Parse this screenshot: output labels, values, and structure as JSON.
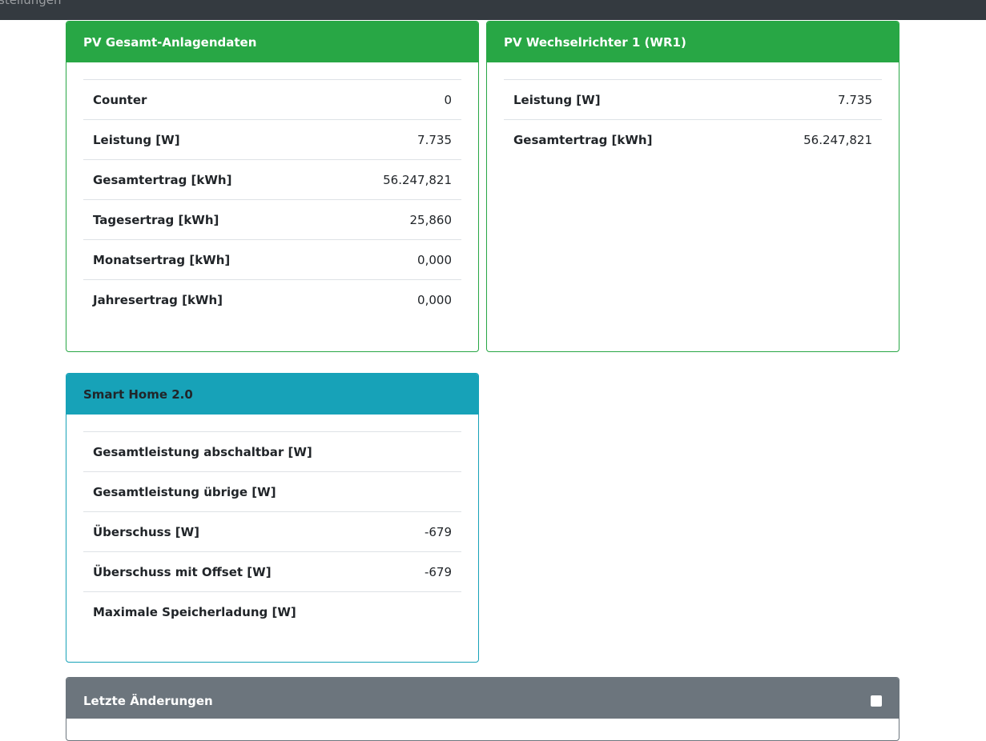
{
  "navbar": {
    "partial_label": "stellungen"
  },
  "pv_total": {
    "title": "PV Gesamt-Anlagendaten",
    "rows": [
      {
        "label": "Counter",
        "value": "0"
      },
      {
        "label": "Leistung [W]",
        "value": "7.735"
      },
      {
        "label": "Gesamtertrag [kWh]",
        "value": "56.247,821"
      },
      {
        "label": "Tagesertrag [kWh]",
        "value": "25,860"
      },
      {
        "label": "Monatsertrag [kWh]",
        "value": "0,000"
      },
      {
        "label": "Jahresertrag [kWh]",
        "value": "0,000"
      }
    ]
  },
  "inverter1": {
    "title": "PV Wechselrichter 1 (WR1)",
    "rows": [
      {
        "label": "Leistung [W]",
        "value": "7.735"
      },
      {
        "label": "Gesamtertrag [kWh]",
        "value": "56.247,821"
      }
    ]
  },
  "smarthome": {
    "title": "Smart Home 2.0",
    "rows": [
      {
        "label": "Gesamtleistung abschaltbar [W]",
        "value": ""
      },
      {
        "label": "Gesamtleistung übrige [W]",
        "value": ""
      },
      {
        "label": "Überschuss [W]",
        "value": "-679"
      },
      {
        "label": "Überschuss mit Offset [W]",
        "value": "-679"
      },
      {
        "label": "Maximale Speicherladung [W]",
        "value": ""
      }
    ]
  },
  "changes": {
    "title": "Letzte Änderungen",
    "icon": "info-icon"
  }
}
